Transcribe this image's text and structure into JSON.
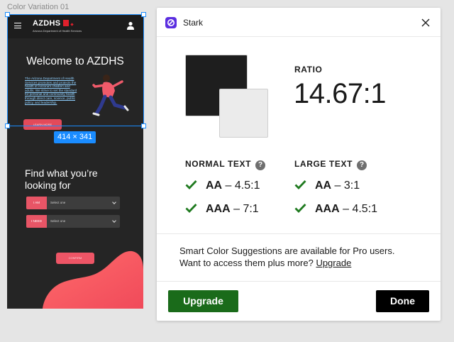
{
  "canvas": {
    "frame_label": "Color Variation 01",
    "selection_dimensions": "414 × 341"
  },
  "mockup": {
    "brand": "AZDHS",
    "brand_subtitle": "Arizona Department of Health Services",
    "welcome_title": "Welcome to AZDHS",
    "intro_text": "The Arizona Department of Health Services promotes and protects the health of Arizona's children and adults. We strive to set the standard for personal and community health through direct care, science, public policy, and leadership.",
    "learn_more": "LEARN MORE",
    "find_title": "Find what you’re looking for",
    "selects": [
      {
        "tag": "I AM",
        "value": "Select one"
      },
      {
        "tag": "I NEED",
        "value": "Select one"
      }
    ],
    "confirm": "CONFIRM",
    "colors": {
      "accent": "#e85566",
      "background": "#252525"
    }
  },
  "stark": {
    "title": "Stark",
    "ratio_label": "RATIO",
    "ratio_value": "14.67:1",
    "foreground_color": "#1e1e1e",
    "background_color": "#ebebeb",
    "normal_text": {
      "heading": "NORMAL TEXT",
      "help": "?",
      "aa_level": "AA",
      "aa_ratio": " – 4.5:1",
      "aaa_level": "AAA",
      "aaa_ratio": " – 7:1"
    },
    "large_text": {
      "heading": "LARGE TEXT",
      "help": "?",
      "aa_level": "AA",
      "aa_ratio": " – 3:1",
      "aaa_level": "AAA",
      "aaa_ratio": " – 4.5:1"
    },
    "promo_line1": "Smart Color Suggestions are available for Pro users.",
    "promo_line2": "Want to access them plus more? ",
    "promo_link": "Upgrade",
    "upgrade_button": "Upgrade",
    "done_button": "Done"
  }
}
